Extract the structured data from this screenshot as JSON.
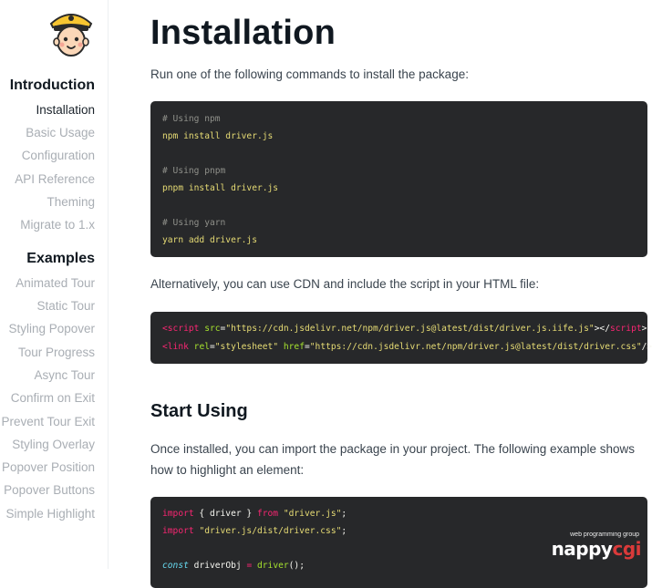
{
  "sidebar": {
    "sections": [
      {
        "heading": "Introduction",
        "items": [
          "Installation",
          "Basic Usage",
          "Configuration",
          "API Reference",
          "Theming",
          "Migrate to 1.x"
        ],
        "active": 0
      },
      {
        "heading": "Examples",
        "items": [
          "Animated Tour",
          "Static Tour",
          "Styling Popover",
          "Tour Progress",
          "Async Tour",
          "Confirm on Exit",
          "Prevent Tour Exit",
          "Styling Overlay",
          "Popover Position",
          "Popover Buttons",
          "Simple Highlight"
        ]
      }
    ]
  },
  "main": {
    "title": "Installation",
    "intro": "Run one of the following commands to install the package:",
    "install": {
      "npm_comment": "# Using npm",
      "npm_cmd": "npm install driver.js",
      "pnpm_comment": "# Using pnpm",
      "pnpm_cmd": "pnpm install driver.js",
      "yarn_comment": "# Using yarn",
      "yarn_cmd": "yarn add driver.js"
    },
    "cdn_text": "Alternatively, you can use CDN and include the script in your HTML file:",
    "cdn": {
      "script_open": "<script",
      "script_attr": "src",
      "script_eq": "=",
      "script_src": "\"https://cdn.jsdelivr.net/npm/driver.js@latest/dist/driver.js.iife.js\"",
      "script_mid": "></",
      "script_close": "script",
      "script_end": ">",
      "link_open": "<link",
      "link_rel_attr": "rel",
      "link_rel_val": "\"stylesheet\"",
      "link_href_attr": "href",
      "link_href_val": "\"https://cdn.jsdelivr.net/npm/driver.js@latest/dist/driver.css\"",
      "link_end": "/>"
    },
    "start_heading": "Start Using",
    "start_text_1": "Once installed, you can import the package in your project. The following example shows",
    "start_text_2": "how to highlight an element:",
    "usage": {
      "import_kw": "import",
      "import_named": " { driver } ",
      "from_kw": "from",
      "import_src": "\"driver.js\"",
      "semi": ";",
      "css_src": "\"driver.js/dist/driver.css\"",
      "const_kw": "const",
      "var_name": " driverObj ",
      "eq": "=",
      "fn_name": "driver",
      "call": "();"
    }
  },
  "watermark": {
    "small": "web programming group",
    "brand_a": "nappy",
    "brand_b": "cgi"
  },
  "colors": {
    "code_bg": "#27282a",
    "comment": "#8f908a",
    "string": "#e6db74",
    "tag": "#f92672",
    "attr": "#a6e22e",
    "active_nav": "#1b232b",
    "inactive_nav": "#a9aeb4"
  }
}
